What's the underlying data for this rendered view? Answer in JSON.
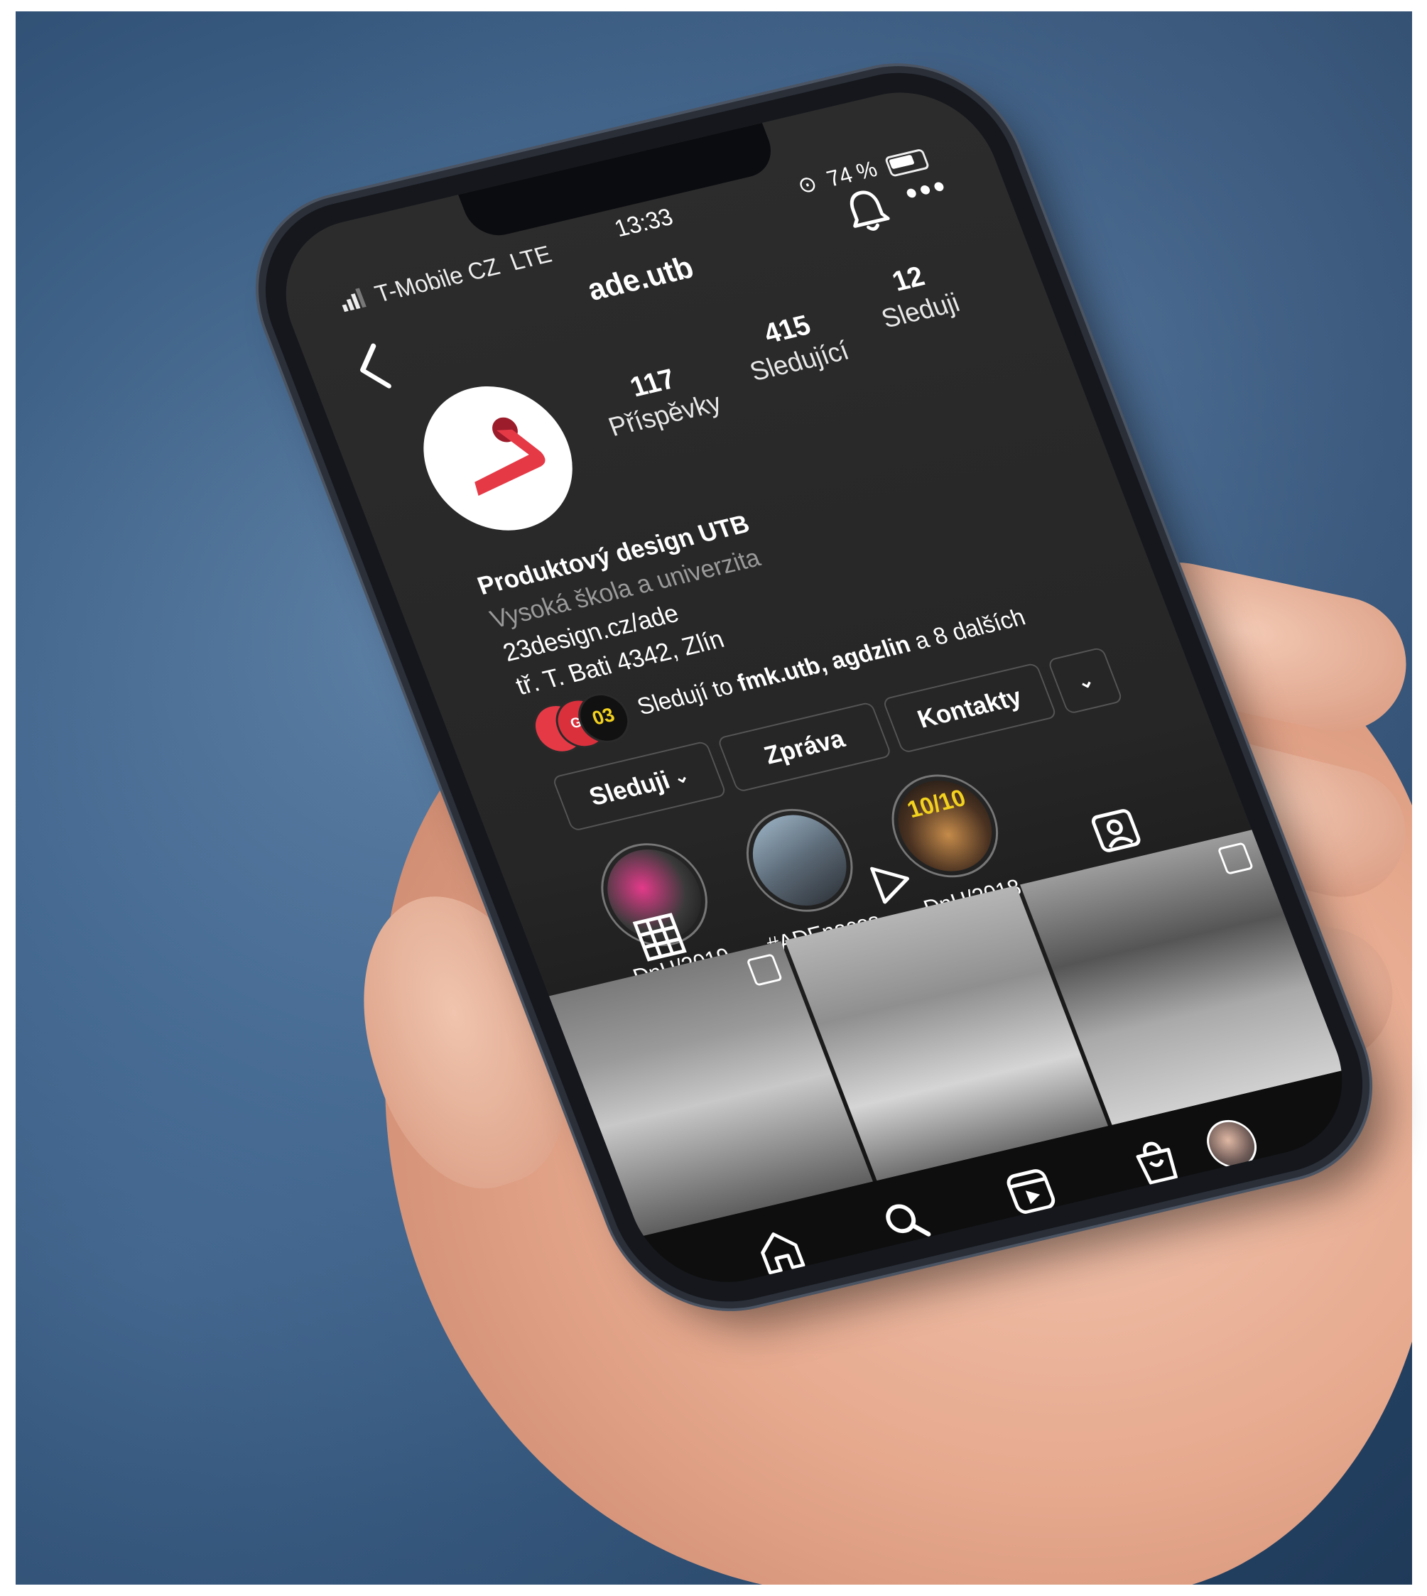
{
  "status_bar": {
    "carrier": "T-Mobile CZ",
    "network": "LTE",
    "time": "13:33",
    "battery": "74 %"
  },
  "header": {
    "username": "ade.utb"
  },
  "profile": {
    "stats": [
      {
        "value": "117",
        "label": "Příspěvky"
      },
      {
        "value": "415",
        "label": "Sledující"
      },
      {
        "value": "12",
        "label": "Sleduji"
      }
    ],
    "name": "Produktový design UTB",
    "category": "Vysoká škola a univerzita",
    "website": "23design.cz/ade",
    "address": "tř. T. Bati 4342, Zlín",
    "followed_by_prefix": "Sledují to ",
    "followed_by_names": "fmk.utb, agdzlin",
    "followed_by_suffix": " a 8 dalších",
    "mini_avatar_text": "GD",
    "mini_avatar_text2": "03"
  },
  "actions": {
    "following": "Sleduji",
    "message": "Zpráva",
    "contacts": "Kontakty"
  },
  "highlights": [
    {
      "label": "DnH/2019"
    },
    {
      "label": "#ADEnaces..."
    },
    {
      "label": "DnH/2018",
      "cover_text": "10/10"
    }
  ],
  "colors": {
    "brand_red": "#e53946",
    "brand_dark_red": "#9c1c2b",
    "background": "#262626",
    "notification_dot": "#ff3040"
  }
}
